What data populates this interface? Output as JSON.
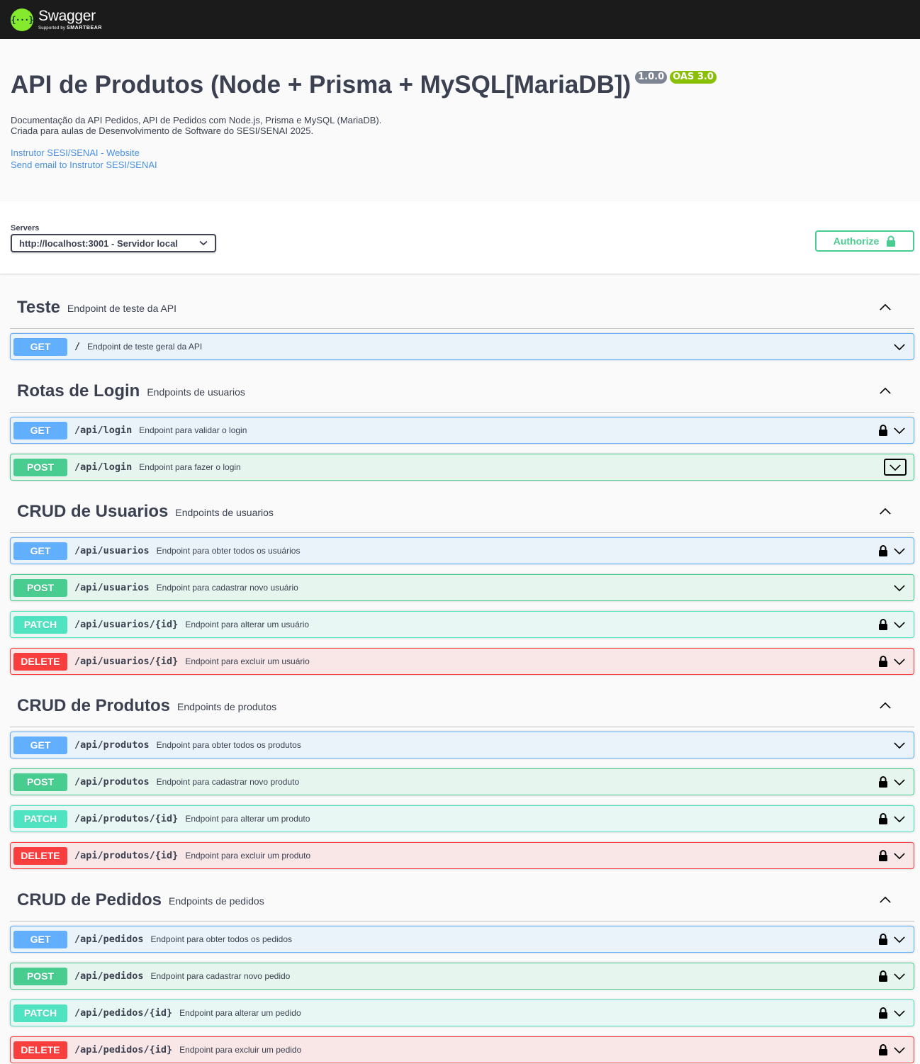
{
  "topbar": {
    "logo_icon": "{···}",
    "logo_name": "Swagger",
    "logo_sub_prefix": "Supported by",
    "logo_sub_brand": "SMARTBEAR"
  },
  "info": {
    "title": "API de Produtos (Node + Prisma + MySQL[MariaDB])",
    "version": "1.0.0",
    "oas": "OAS 3.0",
    "description_line1": "Documentação da API Pedidos, API de Pedidos com Node.js, Prisma e MySQL (MariaDB).",
    "description_line2": "Criada para aulas de Desenvolvimento de Software do SESI/SENAI 2025.",
    "link_website": "Instrutor SESI/SENAI - Website",
    "link_email": "Send email to Instrutor SESI/SENAI"
  },
  "servers": {
    "label": "Servers",
    "selected": "http://localhost:3001 - Servidor local"
  },
  "authorize": {
    "label": "Authorize",
    "icon": "lock-icon"
  },
  "colors": {
    "get": "#61affe",
    "post": "#49cc90",
    "patch": "#50e3c2",
    "delete": "#f93e3e",
    "authorize": "#49cc90"
  },
  "tags": [
    {
      "name": "Teste",
      "description": "Endpoint de teste da API",
      "operations": [
        {
          "method": "GET",
          "path": "/",
          "summary": "Endpoint de teste geral da API",
          "locked": false
        }
      ]
    },
    {
      "name": "Rotas de Login",
      "description": "Endpoints de usuarios",
      "operations": [
        {
          "method": "GET",
          "path": "/api/login",
          "summary": "Endpoint para validar o login",
          "locked": true
        },
        {
          "method": "POST",
          "path": "/api/login",
          "summary": "Endpoint para fazer o login",
          "locked": false,
          "focused": true
        }
      ]
    },
    {
      "name": "CRUD de Usuarios",
      "description": "Endpoints de usuarios",
      "operations": [
        {
          "method": "GET",
          "path": "/api/usuarios",
          "summary": "Endpoint para obter todos os usuários",
          "locked": true
        },
        {
          "method": "POST",
          "path": "/api/usuarios",
          "summary": "Endpoint para cadastrar novo usuário",
          "locked": false
        },
        {
          "method": "PATCH",
          "path": "/api/usuarios/{id}",
          "summary": "Endpoint para alterar um usuário",
          "locked": true
        },
        {
          "method": "DELETE",
          "path": "/api/usuarios/{id}",
          "summary": "Endpoint para excluir um usuário",
          "locked": true
        }
      ]
    },
    {
      "name": "CRUD de Produtos",
      "description": "Endpoints de produtos",
      "operations": [
        {
          "method": "GET",
          "path": "/api/produtos",
          "summary": "Endpoint para obter todos os produtos",
          "locked": false
        },
        {
          "method": "POST",
          "path": "/api/produtos",
          "summary": "Endpoint para cadastrar novo produto",
          "locked": true
        },
        {
          "method": "PATCH",
          "path": "/api/produtos/{id}",
          "summary": "Endpoint para alterar um produto",
          "locked": true
        },
        {
          "method": "DELETE",
          "path": "/api/produtos/{id}",
          "summary": "Endpoint para excluir um produto",
          "locked": true
        }
      ]
    },
    {
      "name": "CRUD de Pedidos",
      "description": "Endpoints de pedidos",
      "operations": [
        {
          "method": "GET",
          "path": "/api/pedidos",
          "summary": "Endpoint para obter todos os pedidos",
          "locked": true
        },
        {
          "method": "POST",
          "path": "/api/pedidos",
          "summary": "Endpoint para cadastrar novo pedido",
          "locked": true
        },
        {
          "method": "PATCH",
          "path": "/api/pedidos/{id}",
          "summary": "Endpoint para alterar um pedido",
          "locked": true
        },
        {
          "method": "DELETE",
          "path": "/api/pedidos/{id}",
          "summary": "Endpoint para excluir um pedido",
          "locked": true
        }
      ]
    }
  ]
}
